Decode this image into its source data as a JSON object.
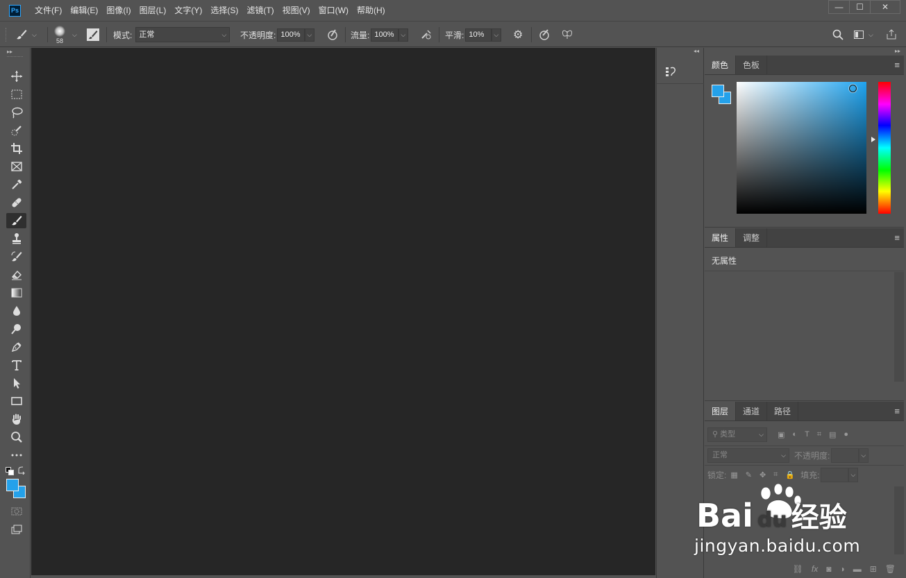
{
  "app": {
    "logo_text": "Ps"
  },
  "menu": [
    "文件(F)",
    "编辑(E)",
    "图像(I)",
    "图层(L)",
    "文字(Y)",
    "选择(S)",
    "滤镜(T)",
    "视图(V)",
    "窗口(W)",
    "帮助(H)"
  ],
  "window_controls": {
    "minimize": "—",
    "maximize": "☐",
    "close": "✕"
  },
  "options": {
    "brush_size": "58",
    "mode_label": "模式:",
    "mode_value": "正常",
    "opacity_label": "不透明度:",
    "opacity_value": "100%",
    "flow_label": "流量:",
    "flow_value": "100%",
    "smoothing_label": "平滑:",
    "smoothing_value": "10%"
  },
  "tools": [
    "move-tool",
    "marquee-tool",
    "lasso-tool",
    "quick-select-tool",
    "crop-tool",
    "frame-tool",
    "eyedropper-tool",
    "healing-brush-tool",
    "brush-tool",
    "clone-stamp-tool",
    "history-brush-tool",
    "eraser-tool",
    "gradient-tool",
    "blur-tool",
    "dodge-tool",
    "pen-tool",
    "type-tool",
    "path-select-tool",
    "rectangle-tool",
    "hand-tool",
    "zoom-tool",
    "more-tools"
  ],
  "colors": {
    "foreground": "#24a1ea",
    "background": "#24a1ea",
    "canvas": "#262626",
    "chrome": "#535353"
  },
  "color_panel": {
    "tabs": [
      "颜色",
      "色板"
    ],
    "active_tab": 0
  },
  "properties_panel": {
    "tabs": [
      "属性",
      "调整"
    ],
    "active_tab": 0,
    "empty_text": "无属性"
  },
  "layers_panel": {
    "tabs": [
      "图层",
      "通道",
      "路径"
    ],
    "active_tab": 0,
    "filter_placeholder": "类型",
    "blend_mode": "正常",
    "opacity_label": "不透明度:",
    "lock_label": "锁定:",
    "fill_label": "填充:"
  },
  "watermark": {
    "brand": "Bai",
    "brand2": "du",
    "brand_cn": "经验",
    "url": "jingyan.baidu.com"
  }
}
